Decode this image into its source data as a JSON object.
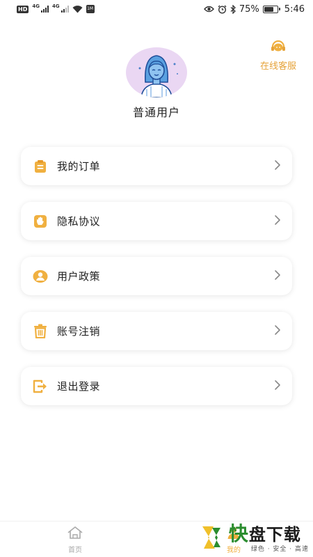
{
  "status_bar": {
    "hd": "HD",
    "net1": "4G",
    "net2": "4G",
    "app_badge": "1M",
    "battery_percent": "75%",
    "battery_level": 0.75,
    "time": "5:46"
  },
  "customer_service": {
    "label": "在线客服",
    "icon": "headset-icon",
    "color": "#e6a33a"
  },
  "profile": {
    "username": "普通用户",
    "avatar_bg": "#ead7f3"
  },
  "menu": {
    "items": [
      {
        "label": "我的订单",
        "icon": "clipboard-icon"
      },
      {
        "label": "隐私协议",
        "icon": "hand-icon"
      },
      {
        "label": "用户政策",
        "icon": "user-circle-icon"
      },
      {
        "label": "账号注销",
        "icon": "trash-icon"
      },
      {
        "label": "退出登录",
        "icon": "logout-icon"
      }
    ]
  },
  "bottom_nav": {
    "home": {
      "label": "首页",
      "icon": "home-icon"
    },
    "mine": {
      "label": "我的",
      "icon": "person-icon"
    }
  },
  "watermark": {
    "kuai": "快",
    "rest": "盘下载",
    "sub": "绿色 · 安全 · 高速"
  },
  "colors": {
    "accent": "#f0b040",
    "accent_dark": "#e6a33a",
    "text": "#222222"
  }
}
